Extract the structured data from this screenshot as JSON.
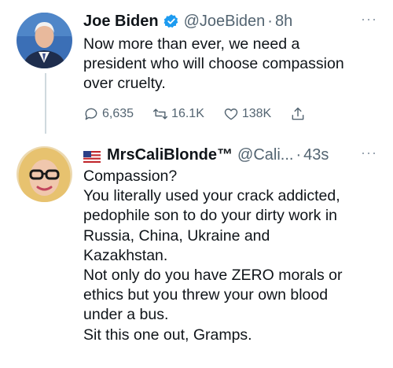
{
  "tweets": [
    {
      "author_name": "Joe Biden",
      "handle": "@JoeBiden",
      "separator": "·",
      "time": "8h",
      "more": "···",
      "text": "Now more than ever, we need a\npresident who will choose compassion\nover cruelty.",
      "replies": "6,635",
      "retweets": "16.1K",
      "likes": "138K"
    },
    {
      "author_name": "MrsCaliBlonde™",
      "handle": "@Cali...",
      "separator": "·",
      "time": "43s",
      "more": "···",
      "text": "Compassion?\nYou literally used your crack addicted,\npedophile son to do your dirty work in\nRussia, China, Ukraine and\nKazakhstan.\nNot only do you have ZERO morals or\nethics but you threw your own blood\nunder a bus.\nSit this one out, Gramps."
    }
  ],
  "colors": {
    "verified": "#1d9bf0",
    "secondary_text": "#536471",
    "thread_line": "#cfd9de"
  },
  "icons": [
    "reply-icon",
    "retweet-icon",
    "like-icon",
    "share-icon",
    "verified-badge-icon",
    "us-flag-icon",
    "more-options-icon"
  ]
}
